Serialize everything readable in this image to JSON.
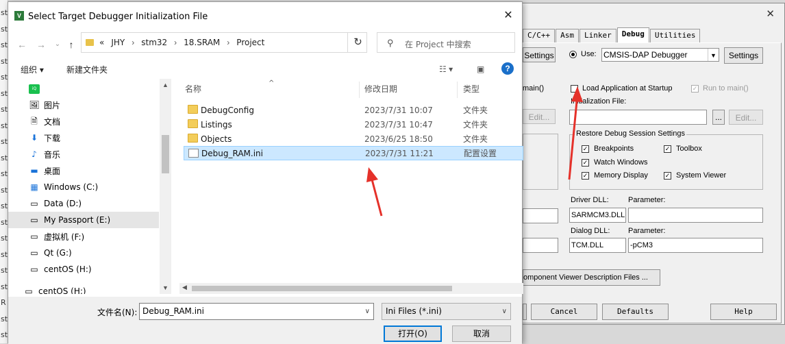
{
  "background_strip": {
    "items": [
      "st",
      "st",
      "st",
      "st",
      "st",
      "st",
      "st",
      "st",
      "st",
      "st",
      "st",
      "st",
      "st",
      "st",
      "st",
      "st",
      "st",
      "st",
      "R",
      "st",
      "st"
    ]
  },
  "file_dialog": {
    "title": "Select Target Debugger Initialization File",
    "address": {
      "prefix": "«",
      "crumbs": [
        "JHY",
        "stm32",
        "18.SRAM",
        "Project"
      ]
    },
    "search_placeholder": "在 Project 中搜索",
    "toolbar": {
      "organize": "组织 ▾",
      "new_folder": "新建文件夹",
      "help": "?"
    },
    "nav_items": [
      {
        "label": "",
        "icon": "iqiyi-icon"
      },
      {
        "label": "图片",
        "icon": "pictures-icon"
      },
      {
        "label": "文档",
        "icon": "documents-icon"
      },
      {
        "label": "下载",
        "icon": "downloads-icon"
      },
      {
        "label": "音乐",
        "icon": "music-icon"
      },
      {
        "label": "桌面",
        "icon": "desktop-icon"
      },
      {
        "label": "Windows (C:)",
        "icon": "drive-icon"
      },
      {
        "label": "Data (D:)",
        "icon": "drive-icon"
      },
      {
        "label": "My Passport (E:)",
        "icon": "drive-icon"
      },
      {
        "label": "虚拟机 (F:)",
        "icon": "drive-icon"
      },
      {
        "label": "Qt (G:)",
        "icon": "drive-icon"
      },
      {
        "label": "centOS (H:)",
        "icon": "drive-icon"
      },
      {
        "label": "centOS (H:)",
        "icon": "drive-icon"
      }
    ],
    "columns": {
      "name": "名称",
      "date": "修改日期",
      "type": "类型"
    },
    "files": [
      {
        "name": "DebugConfig",
        "date": "2023/7/31 10:07",
        "type": "文件夹",
        "kind": "folder"
      },
      {
        "name": "Listings",
        "date": "2023/7/31 10:47",
        "type": "文件夹",
        "kind": "folder"
      },
      {
        "name": "Objects",
        "date": "2023/6/25 18:50",
        "type": "文件夹",
        "kind": "folder"
      },
      {
        "name": "Debug_RAM.ini",
        "date": "2023/7/31 11:21",
        "type": "配置设置",
        "kind": "ini"
      }
    ],
    "filename_label": "文件名(N):",
    "filename_value": "Debug_RAM.ini",
    "filetype_value": "Ini Files (*.ini)",
    "open_button": "打开(O)",
    "cancel_button": "取消"
  },
  "options_dialog": {
    "tabs": [
      "C/C++",
      "Asm",
      "Linker",
      "Debug",
      "Utilities"
    ],
    "active_tab": "Debug",
    "settings_left": "Settings",
    "use_label": "Use:",
    "debugger_value": "CMSIS-DAP Debugger",
    "settings_right": "Settings",
    "main_partial": "main()",
    "load_app": "Load Application at Startup",
    "run_to_main": "Run to main()",
    "init_file_label": "Initialization File:",
    "browse": "...",
    "edit_right": "Edit...",
    "edit_left": "Edit...",
    "restore_group": "Restore Debug Session Settings",
    "breakpoints": "Breakpoints",
    "toolbox": "Toolbox",
    "watch_windows": "Watch Windows",
    "memory_display": "Memory Display",
    "system_viewer": "System Viewer",
    "driver_dll_label": "Driver DLL:",
    "driver_dll_value": "SARMCM3.DLL",
    "parameter_label": "Parameter:",
    "dialog_dll_label": "Dialog DLL:",
    "dialog_dll_value": "TCM.DLL",
    "dialog_param_value": "-pCM3",
    "component_viewer": "omponent Viewer Description Files ...",
    "bottom_cancel": "Cancel",
    "bottom_defaults": "Defaults",
    "bottom_help": "Help"
  }
}
